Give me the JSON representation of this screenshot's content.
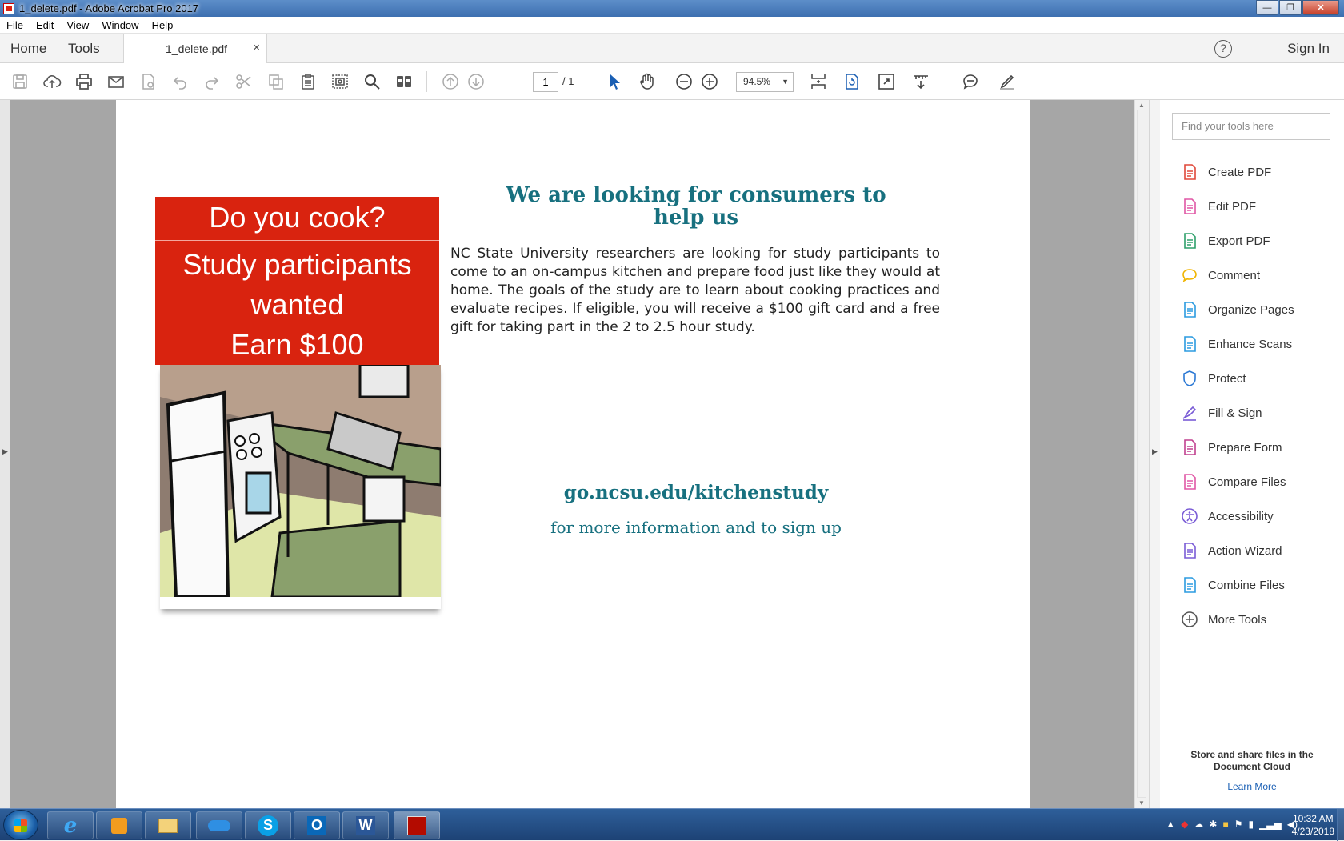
{
  "window": {
    "title": "1_delete.pdf - Adobe Acrobat Pro 2017",
    "min_glyph": "—",
    "max_glyph": "❐",
    "close_glyph": "✕"
  },
  "menu": [
    "File",
    "Edit",
    "View",
    "Window",
    "Help"
  ],
  "tabs": {
    "home": "Home",
    "tools": "Tools",
    "document": "1_delete.pdf",
    "close_glyph": "×",
    "help_glyph": "?",
    "signin": "Sign In"
  },
  "toolbar": {
    "page_current": "1",
    "page_total": "/ 1",
    "zoom": "94.5%",
    "zoom_caret": "▼"
  },
  "flyer": {
    "box_line1": "Do you cook?",
    "box_line2": "Study participants",
    "box_line3": "wanted",
    "box_line4": "Earn $100",
    "headline_1": "We are looking for consumers to",
    "headline_2": "help us",
    "body": "NC State University researchers are looking for study participants to come to an on-campus kitchen and prepare food just like they would at home. The goals of the study are to learn about cooking practices and evaluate recipes. If eligible, you will receive a $100 gift card and a free gift for taking part in the 2 to 2.5 hour study.",
    "url": "go.ncsu.edu/kitchenstudy",
    "url_sub": "for more information and to sign up"
  },
  "right_panel": {
    "search_placeholder": "Find your tools here",
    "tools": [
      {
        "label": "Create PDF",
        "icon": "create-pdf-icon",
        "color": "#e0483a"
      },
      {
        "label": "Edit PDF",
        "icon": "edit-pdf-icon",
        "color": "#e056a5"
      },
      {
        "label": "Export PDF",
        "icon": "export-pdf-icon",
        "color": "#2ea06b"
      },
      {
        "label": "Comment",
        "icon": "comment-icon",
        "color": "#f0b400"
      },
      {
        "label": "Organize Pages",
        "icon": "organize-pages-icon",
        "color": "#2b9be0"
      },
      {
        "label": "Enhance Scans",
        "icon": "enhance-scans-icon",
        "color": "#2b9be0"
      },
      {
        "label": "Protect",
        "icon": "protect-icon",
        "color": "#2b78d4"
      },
      {
        "label": "Fill & Sign",
        "icon": "fill-sign-icon",
        "color": "#7a5cd6"
      },
      {
        "label": "Prepare Form",
        "icon": "prepare-form-icon",
        "color": "#c1408f"
      },
      {
        "label": "Compare Files",
        "icon": "compare-files-icon",
        "color": "#e056a5"
      },
      {
        "label": "Accessibility",
        "icon": "accessibility-icon",
        "color": "#7a5cd6"
      },
      {
        "label": "Action Wizard",
        "icon": "action-wizard-icon",
        "color": "#7a5cd6"
      },
      {
        "label": "Combine Files",
        "icon": "combine-files-icon",
        "color": "#2b9be0"
      },
      {
        "label": "More Tools",
        "icon": "more-tools-icon",
        "color": "#555555"
      }
    ],
    "cloud_text_1": "Store and share files in the",
    "cloud_text_2": "Document Cloud",
    "learn_more": "Learn More"
  },
  "taskbar": {
    "time": "10:32 AM",
    "date": "4/23/2018",
    "apps": [
      "internet-explorer",
      "media-player",
      "file-explorer",
      "onedrive",
      "skype",
      "outlook",
      "word",
      "acrobat"
    ],
    "labels": {
      "skype": "S",
      "outlook": "O",
      "word": "W"
    }
  }
}
